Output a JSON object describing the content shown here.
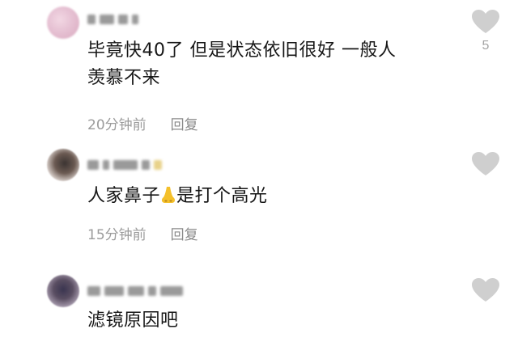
{
  "comments": [
    {
      "text_line1": "毕竟快40了 但是状态依旧很好 一般人",
      "text_line2": "羡慕不来",
      "time": "20分钟前",
      "reply": "回复",
      "likes": "5"
    },
    {
      "text_before_emoji": "人家鼻子",
      "emoji": "nose-emoji",
      "text_after_emoji": "是打个高光",
      "time": "15分钟前",
      "reply": "回复"
    },
    {
      "text": "滤镜原因吧"
    }
  ],
  "icons": {
    "like": "heart-icon"
  },
  "colors": {
    "heart": "#cfcfcf",
    "meta_text": "#9b9b9b",
    "body_text": "#161616"
  }
}
